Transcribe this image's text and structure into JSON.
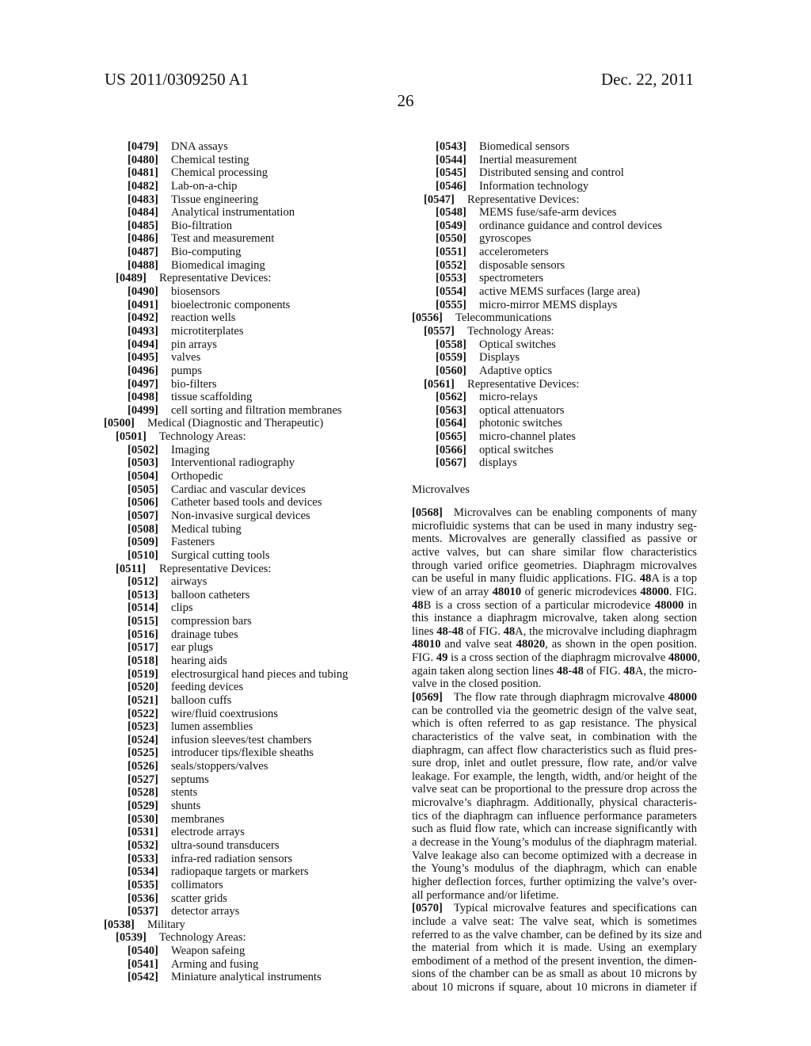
{
  "header": {
    "publication_number": "US 2011/0309250 A1",
    "date": "Dec. 22, 2011",
    "page_number": "26"
  },
  "left_column": [
    {
      "level": 2,
      "num": "[0479]",
      "text": "DNA assays"
    },
    {
      "level": 2,
      "num": "[0480]",
      "text": "Chemical testing"
    },
    {
      "level": 2,
      "num": "[0481]",
      "text": "Chemical processing"
    },
    {
      "level": 2,
      "num": "[0482]",
      "text": "Lab-on-a-chip"
    },
    {
      "level": 2,
      "num": "[0483]",
      "text": "Tissue engineering"
    },
    {
      "level": 2,
      "num": "[0484]",
      "text": "Analytical instrumentation"
    },
    {
      "level": 2,
      "num": "[0485]",
      "text": "Bio-filtration"
    },
    {
      "level": 2,
      "num": "[0486]",
      "text": "Test and measurement"
    },
    {
      "level": 2,
      "num": "[0487]",
      "text": "Bio-computing"
    },
    {
      "level": 2,
      "num": "[0488]",
      "text": "Biomedical imaging"
    },
    {
      "level": 1,
      "num": "[0489]",
      "text": "Representative Devices:"
    },
    {
      "level": 2,
      "num": "[0490]",
      "text": "biosensors"
    },
    {
      "level": 2,
      "num": "[0491]",
      "text": "bioelectronic components"
    },
    {
      "level": 2,
      "num": "[0492]",
      "text": "reaction wells"
    },
    {
      "level": 2,
      "num": "[0493]",
      "text": "microtiterplates"
    },
    {
      "level": 2,
      "num": "[0494]",
      "text": "pin arrays"
    },
    {
      "level": 2,
      "num": "[0495]",
      "text": "valves"
    },
    {
      "level": 2,
      "num": "[0496]",
      "text": "pumps"
    },
    {
      "level": 2,
      "num": "[0497]",
      "text": "bio-filters"
    },
    {
      "level": 2,
      "num": "[0498]",
      "text": "tissue scaffolding"
    },
    {
      "level": 2,
      "num": "[0499]",
      "text": "cell sorting and filtration membranes"
    },
    {
      "level": 0,
      "num": "[0500]",
      "text": "Medical (Diagnostic and Therapeutic)"
    },
    {
      "level": 1,
      "num": "[0501]",
      "text": "Technology Areas:"
    },
    {
      "level": 2,
      "num": "[0502]",
      "text": "Imaging"
    },
    {
      "level": 2,
      "num": "[0503]",
      "text": "Interventional radiography"
    },
    {
      "level": 2,
      "num": "[0504]",
      "text": "Orthopedic"
    },
    {
      "level": 2,
      "num": "[0505]",
      "text": "Cardiac and vascular devices"
    },
    {
      "level": 2,
      "num": "[0506]",
      "text": "Catheter based tools and devices"
    },
    {
      "level": 2,
      "num": "[0507]",
      "text": "Non-invasive surgical devices"
    },
    {
      "level": 2,
      "num": "[0508]",
      "text": "Medical tubing"
    },
    {
      "level": 2,
      "num": "[0509]",
      "text": "Fasteners"
    },
    {
      "level": 2,
      "num": "[0510]",
      "text": "Surgical cutting tools"
    },
    {
      "level": 1,
      "num": "[0511]",
      "text": "Representative Devices:"
    },
    {
      "level": 2,
      "num": "[0512]",
      "text": "airways"
    },
    {
      "level": 2,
      "num": "[0513]",
      "text": "balloon catheters"
    },
    {
      "level": 2,
      "num": "[0514]",
      "text": "clips"
    },
    {
      "level": 2,
      "num": "[0515]",
      "text": "compression bars"
    },
    {
      "level": 2,
      "num": "[0516]",
      "text": "drainage tubes"
    },
    {
      "level": 2,
      "num": "[0517]",
      "text": "ear plugs"
    },
    {
      "level": 2,
      "num": "[0518]",
      "text": "hearing aids"
    },
    {
      "level": 2,
      "num": "[0519]",
      "text": "electrosurgical hand pieces and tubing"
    },
    {
      "level": 2,
      "num": "[0520]",
      "text": "feeding devices"
    },
    {
      "level": 2,
      "num": "[0521]",
      "text": "balloon cuffs"
    },
    {
      "level": 2,
      "num": "[0522]",
      "text": "wire/fluid coextrusions"
    },
    {
      "level": 2,
      "num": "[0523]",
      "text": "lumen assemblies"
    },
    {
      "level": 2,
      "num": "[0524]",
      "text": "infusion sleeves/test chambers"
    },
    {
      "level": 2,
      "num": "[0525]",
      "text": "introducer tips/flexible sheaths"
    },
    {
      "level": 2,
      "num": "[0526]",
      "text": "seals/stoppers/valves"
    },
    {
      "level": 2,
      "num": "[0527]",
      "text": "septums"
    },
    {
      "level": 2,
      "num": "[0528]",
      "text": "stents"
    },
    {
      "level": 2,
      "num": "[0529]",
      "text": "shunts"
    },
    {
      "level": 2,
      "num": "[0530]",
      "text": "membranes"
    },
    {
      "level": 2,
      "num": "[0531]",
      "text": "electrode arrays"
    },
    {
      "level": 2,
      "num": "[0532]",
      "text": "ultra-sound transducers"
    },
    {
      "level": 2,
      "num": "[0533]",
      "text": "infra-red radiation sensors"
    },
    {
      "level": 2,
      "num": "[0534]",
      "text": "radiopaque targets or markers"
    },
    {
      "level": 2,
      "num": "[0535]",
      "text": "collimators"
    },
    {
      "level": 2,
      "num": "[0536]",
      "text": "scatter grids"
    },
    {
      "level": 2,
      "num": "[0537]",
      "text": "detector arrays"
    },
    {
      "level": 0,
      "num": "[0538]",
      "text": "Military"
    },
    {
      "level": 1,
      "num": "[0539]",
      "text": "Technology Areas:"
    },
    {
      "level": 2,
      "num": "[0540]",
      "text": "Weapon safeing"
    },
    {
      "level": 2,
      "num": "[0541]",
      "text": "Arming and fusing"
    },
    {
      "level": 2,
      "num": "[0542]",
      "text": "Miniature analytical instruments"
    }
  ],
  "right_column_list": [
    {
      "level": 2,
      "num": "[0543]",
      "text": "Biomedical sensors"
    },
    {
      "level": 2,
      "num": "[0544]",
      "text": "Inertial measurement"
    },
    {
      "level": 2,
      "num": "[0545]",
      "text": "Distributed sensing and control"
    },
    {
      "level": 2,
      "num": "[0546]",
      "text": "Information technology"
    },
    {
      "level": 1,
      "num": "[0547]",
      "text": "Representative Devices:"
    },
    {
      "level": 2,
      "num": "[0548]",
      "text": "MEMS fuse/safe-arm devices"
    },
    {
      "level": 2,
      "num": "[0549]",
      "text": "ordinance guidance and control devices"
    },
    {
      "level": 2,
      "num": "[0550]",
      "text": "gyroscopes"
    },
    {
      "level": 2,
      "num": "[0551]",
      "text": "accelerometers"
    },
    {
      "level": 2,
      "num": "[0552]",
      "text": "disposable sensors"
    },
    {
      "level": 2,
      "num": "[0553]",
      "text": "spectrometers"
    },
    {
      "level": 2,
      "num": "[0554]",
      "text": "active MEMS surfaces (large area)"
    },
    {
      "level": 2,
      "num": "[0555]",
      "text": "micro-mirror MEMS displays"
    },
    {
      "level": 0,
      "num": "[0556]",
      "text": "Telecommunications"
    },
    {
      "level": 1,
      "num": "[0557]",
      "text": "Technology Areas:"
    },
    {
      "level": 2,
      "num": "[0558]",
      "text": "Optical switches"
    },
    {
      "level": 2,
      "num": "[0559]",
      "text": "Displays"
    },
    {
      "level": 2,
      "num": "[0560]",
      "text": "Adaptive optics"
    },
    {
      "level": 1,
      "num": "[0561]",
      "text": "Representative Devices:"
    },
    {
      "level": 2,
      "num": "[0562]",
      "text": "micro-relays"
    },
    {
      "level": 2,
      "num": "[0563]",
      "text": "optical attenuators"
    },
    {
      "level": 2,
      "num": "[0564]",
      "text": "photonic switches"
    },
    {
      "level": 2,
      "num": "[0565]",
      "text": "micro-channel plates"
    },
    {
      "level": 2,
      "num": "[0566]",
      "text": "optical switches"
    },
    {
      "level": 2,
      "num": "[0567]",
      "text": "displays"
    }
  ],
  "section_heading": "Microvalves",
  "paragraphs": [
    {
      "num": "[0568]",
      "lines": [
        "Microvalves can be enabling components of many",
        "microfluidic systems that can be used in many industry seg-",
        "ments. Microvalves are generally classified as passive or",
        "active valves, but can share similar flow characteristics",
        "through varied orifice geometries. Diaphragm microvalves",
        "can be useful in many fluidic applications. FIG. <b>48</b>A is a top",
        "view of an array <b>48010</b> of generic microdevices <b>48000</b>. FIG.",
        "<b>48</b>B is a cross section of a particular microdevice <b>48000</b> in",
        "this instance a diaphragm microvalve, taken along section",
        "lines <b>48-48</b> of FIG. <b>48</b>A, the microvalve including diaphragm",
        "<b>48010</b> and valve seat <b>48020</b>, as shown in the open position.",
        "FIG. <b>49</b> is a cross section of the diaphragm microvalve <b>48000</b>,",
        "again taken along section lines <b>48-48</b> of FIG. <b>48</b>A, the micro-",
        "valve in the closed position."
      ]
    },
    {
      "num": "[0569]",
      "lines": [
        "The flow rate through diaphragm microvalve <b>48000</b>",
        "can be controlled via the geometric design of the valve seat,",
        "which is often referred to as gap resistance. The physical",
        "characteristics of the valve seat, in combination with the",
        "diaphragm, can affect flow characteristics such as fluid pres-",
        "sure drop, inlet and outlet pressure, flow rate, and/or valve",
        "leakage. For example, the length, width, and/or height of the",
        "valve seat can be proportional to the pressure drop across the",
        "microvalve’s diaphragm. Additionally, physical characteris-",
        "tics of the diaphragm can influence performance parameters",
        "such as fluid flow rate, which can increase significantly with",
        "a decrease in the Young’s modulus of the diaphragm material.",
        "Valve leakage also can become optimized with a decrease in",
        "the Young’s modulus of the diaphragm, which can enable",
        "higher deflection forces, further optimizing the valve’s over-",
        "all performance and/or lifetime."
      ]
    },
    {
      "num": "[0570]",
      "continues": true,
      "lines": [
        "Typical microvalve features and specifications can",
        "include a valve seat: The valve seat, which is sometimes",
        "referred to as the valve chamber, can be defined by its size and",
        "the material from which it is made. Using an exemplary",
        "embodiment of a method of the present invention, the dimen-",
        "sions of the chamber can be as small as about 10 microns by",
        "about 10 microns if square, about 10 microns in diameter if"
      ]
    }
  ]
}
